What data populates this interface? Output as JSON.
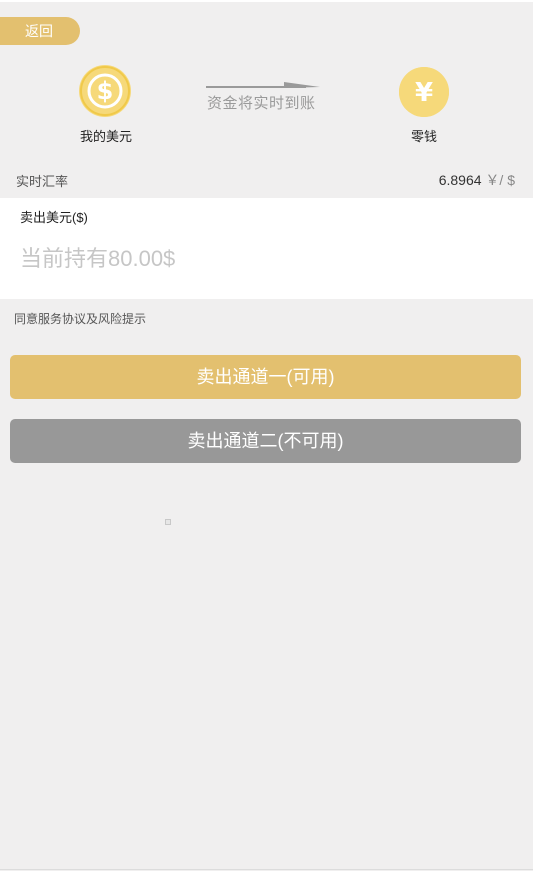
{
  "nav": {
    "back_label": "返回"
  },
  "exchange": {
    "from_label": "我的美元",
    "to_label": "零钱",
    "arrow_text": "资金将实时到账",
    "from_icon": "dollar-coin-icon",
    "to_icon": "yuan-coin-icon"
  },
  "rate": {
    "label": "实时汇率",
    "value": "6.8964",
    "unit": "￥/ $"
  },
  "sell": {
    "title": "卖出美元($)",
    "placeholder": "当前持有80.00$",
    "value": ""
  },
  "agreement": {
    "text": "同意服务协议及风险提示"
  },
  "channels": [
    {
      "label": "卖出通道一(可用)",
      "available": true
    },
    {
      "label": "卖出通道二(不可用)",
      "available": false
    }
  ],
  "colors": {
    "accent": "#e3c06f",
    "icon_fill": "#f6d97a",
    "disabled": "#989898",
    "background": "#f0efef"
  }
}
